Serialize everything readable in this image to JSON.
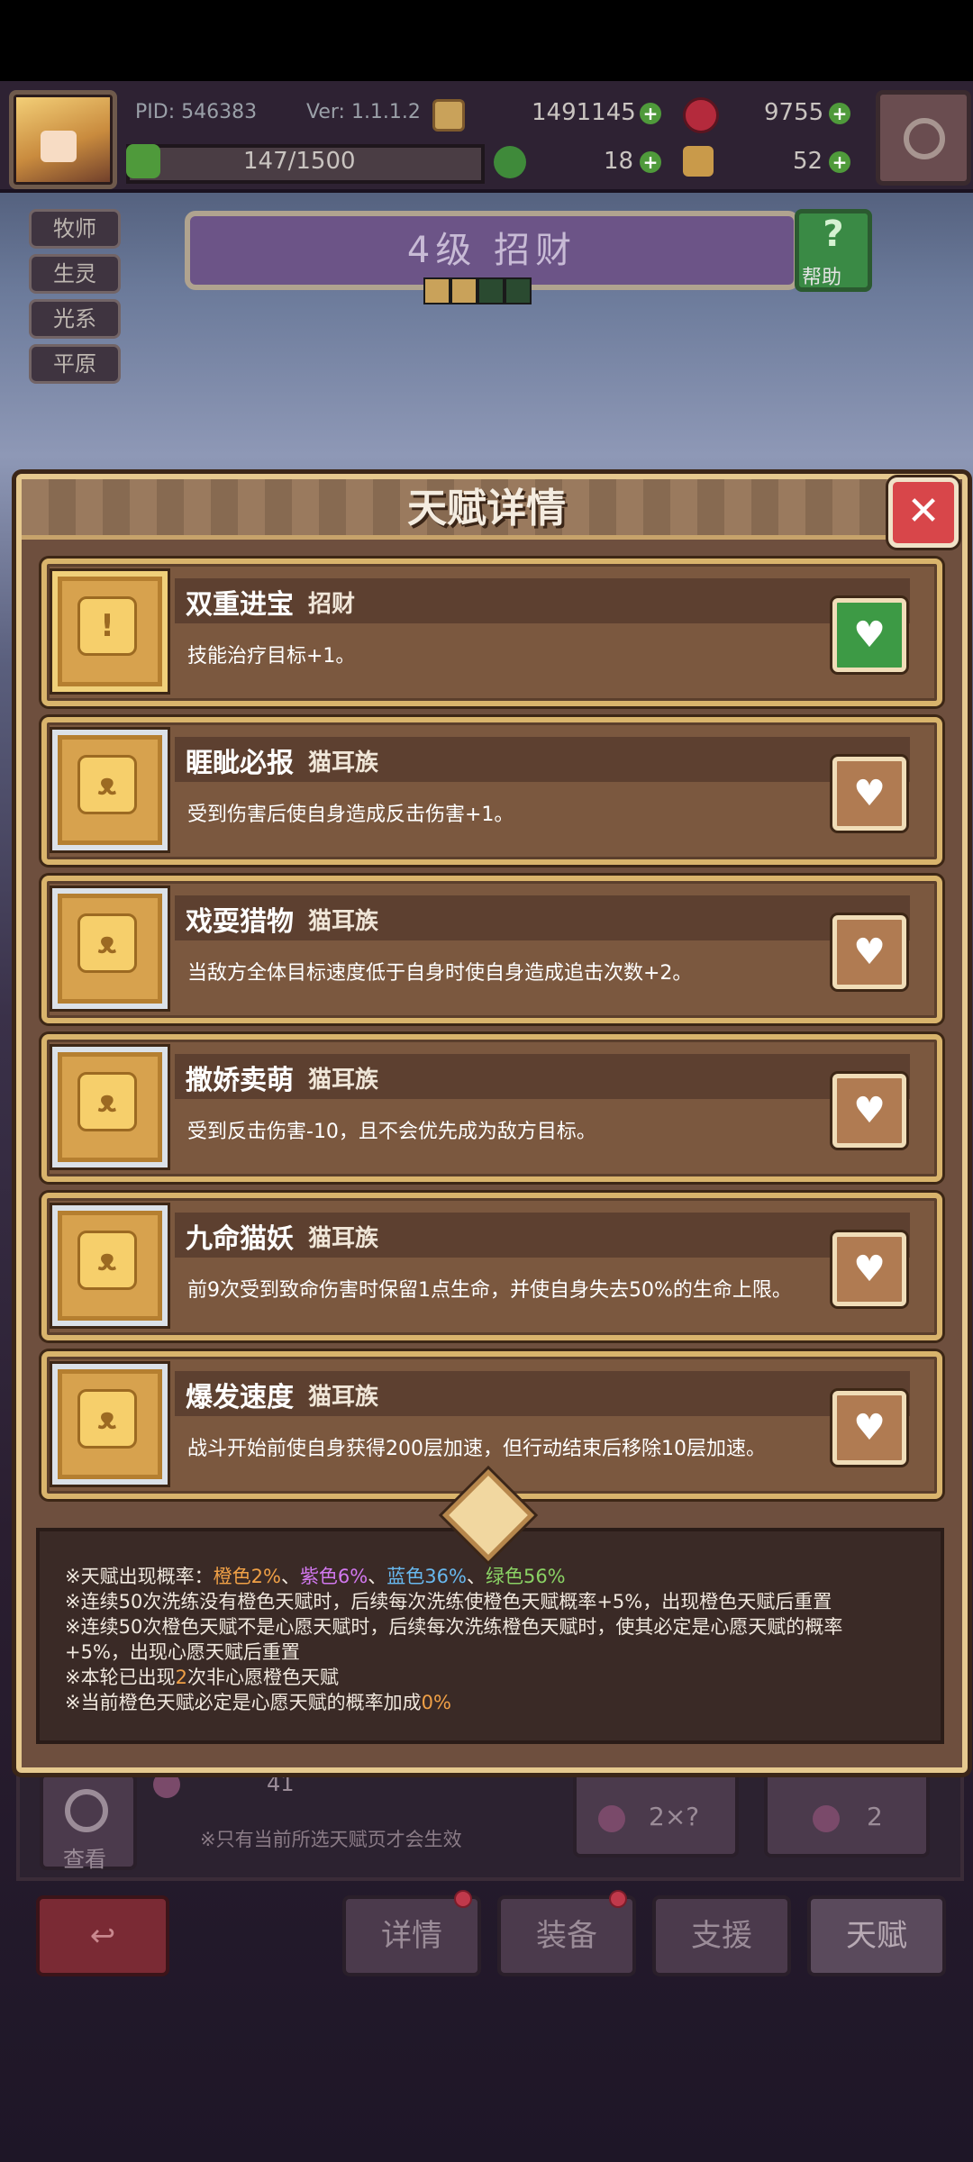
{
  "header": {
    "pid": "PID: 546383",
    "version": "Ver: 1.1.1.2",
    "gold": "1491145",
    "gems": "9755",
    "exp": "147/1500",
    "clover": "18",
    "fist": "52"
  },
  "tags": [
    "牧师",
    "生灵",
    "光系",
    "平原"
  ],
  "hero": {
    "title": "4级 招财",
    "help_label": "帮助",
    "help_icon": "?"
  },
  "dialog": {
    "title": "天赋详情",
    "close_icon": "✕",
    "talents": [
      {
        "name": "双重进宝",
        "type": "招财",
        "desc": "技能治疗目标+1。",
        "wished": true
      },
      {
        "name": "睚眦必报",
        "type": "猫耳族",
        "desc": "受到伤害后使自身造成反击伤害+1。",
        "wished": false
      },
      {
        "name": "戏耍猎物",
        "type": "猫耳族",
        "desc": "当敌方全体目标速度低于自身时使自身造成追击次数+2。",
        "wished": false
      },
      {
        "name": "撒娇卖萌",
        "type": "猫耳族",
        "desc": "受到反击伤害-10，且不会优先成为敌方目标。",
        "wished": false
      },
      {
        "name": "九命猫妖",
        "type": "猫耳族",
        "desc": "前9次受到致命伤害时保留1点生命，并使自身失去50%的生命上限。",
        "wished": false
      },
      {
        "name": "爆发速度",
        "type": "猫耳族",
        "desc": "战斗开始前使自身获得200层加速，但行动结束后移除10层加速。",
        "wished": false
      }
    ],
    "info": {
      "rate_prefix": "※天赋出现概率：",
      "orange": "橙色2%",
      "purple": "紫色6%",
      "blue": "蓝色36%",
      "green": "绿色56%",
      "sep": "、",
      "line2": "※连续50次洗练没有橙色天赋时，后续每次洗练使橙色天赋概率+5%，出现橙色天赋后重置",
      "line3": "※连续50次橙色天赋不是心愿天赋时，后续每次洗练橙色天赋时，使其必定是心愿天赋的概率",
      "line4": "+5%，出现心愿天赋后重置",
      "line5_a": "※本轮已出现",
      "line5_num": "2",
      "line5_b": "次非心愿橙色天赋",
      "line6_a": "※当前橙色天赋必定是心愿天赋的概率加成",
      "line6_num": "0%"
    }
  },
  "below": {
    "count": "41",
    "view_label": "查看",
    "hint": "※只有当前所选天赋页才会生效",
    "auto_cost": "2×?",
    "talent_cost": "2"
  },
  "nav": {
    "details": "详情",
    "equip": "装备",
    "support": "支援",
    "talent": "天赋"
  }
}
